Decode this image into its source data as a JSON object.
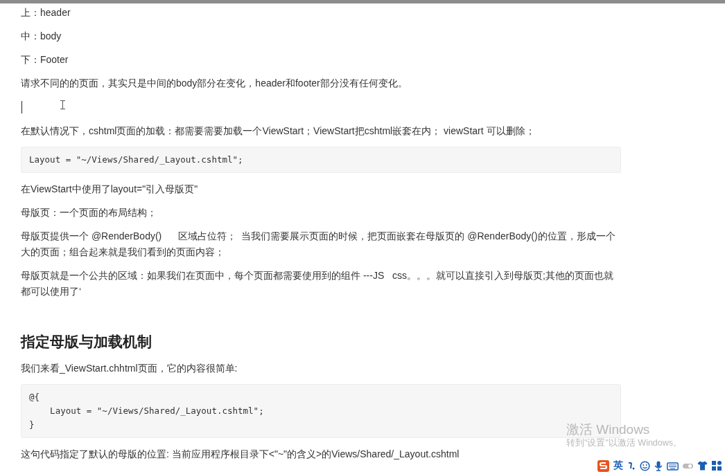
{
  "document": {
    "blocks": [
      {
        "kind": "paragraph",
        "text": "上：header"
      },
      {
        "kind": "paragraph",
        "text": "中：body"
      },
      {
        "kind": "paragraph",
        "text": "下：Footer"
      },
      {
        "kind": "paragraph",
        "text": "请求不同的的页面，其实只是中间的body部分在变化，header和footer部分没有任何变化。"
      },
      {
        "kind": "empty_line"
      },
      {
        "kind": "paragraph",
        "text": "在默认情况下，cshtml页面的加载：都需要需要加载一个ViewStart；ViewStart把cshtml嵌套在内； viewStart 可以删除；"
      },
      {
        "kind": "code",
        "lines": [
          "Layout = \"~/Views/Shared/_Layout.cshtml\";"
        ]
      },
      {
        "kind": "paragraph",
        "text": "在ViewStart中使用了layout=\"引入母版页\""
      },
      {
        "kind": "paragraph",
        "text": "母版页：一个页面的布局结构；"
      },
      {
        "kind": "paragraph",
        "text": "母版页提供一个 @RenderBody()      区域占位符；  当我们需要展示页面的时候，把页面嵌套在母版页的 @RenderBody()的位置，形成一个大的页面；组合起来就是我们看到的页面内容；"
      },
      {
        "kind": "paragraph",
        "text": "母版页就是一个公共的区域：如果我们在页面中，每个页面都需要使用到的组件 ---JS   css。。。就可以直接引入到母版页;其他的页面也就都可以使用了‘"
      },
      {
        "kind": "heading",
        "text": "指定母版与加载机制"
      },
      {
        "kind": "paragraph",
        "text": "我们来看_ViewStart.chhtml页面，它的内容很简单:"
      },
      {
        "kind": "code",
        "lines": [
          "@{",
          "    Layout = \"~/Views/Shared/_Layout.cshtml\";",
          "}"
        ]
      },
      {
        "kind": "paragraph",
        "text": "这句代码指定了默认的母版的位置: 当前应用程序根目录下<\"~\"的含义>的Views/Shared/_Layout.cshtml"
      }
    ]
  },
  "activation_notice": {
    "title": "激活 Windows",
    "subtitle": "转到\"设置\"以激活 Windows。"
  },
  "ime_toolbar": {
    "mode_label": "英"
  }
}
